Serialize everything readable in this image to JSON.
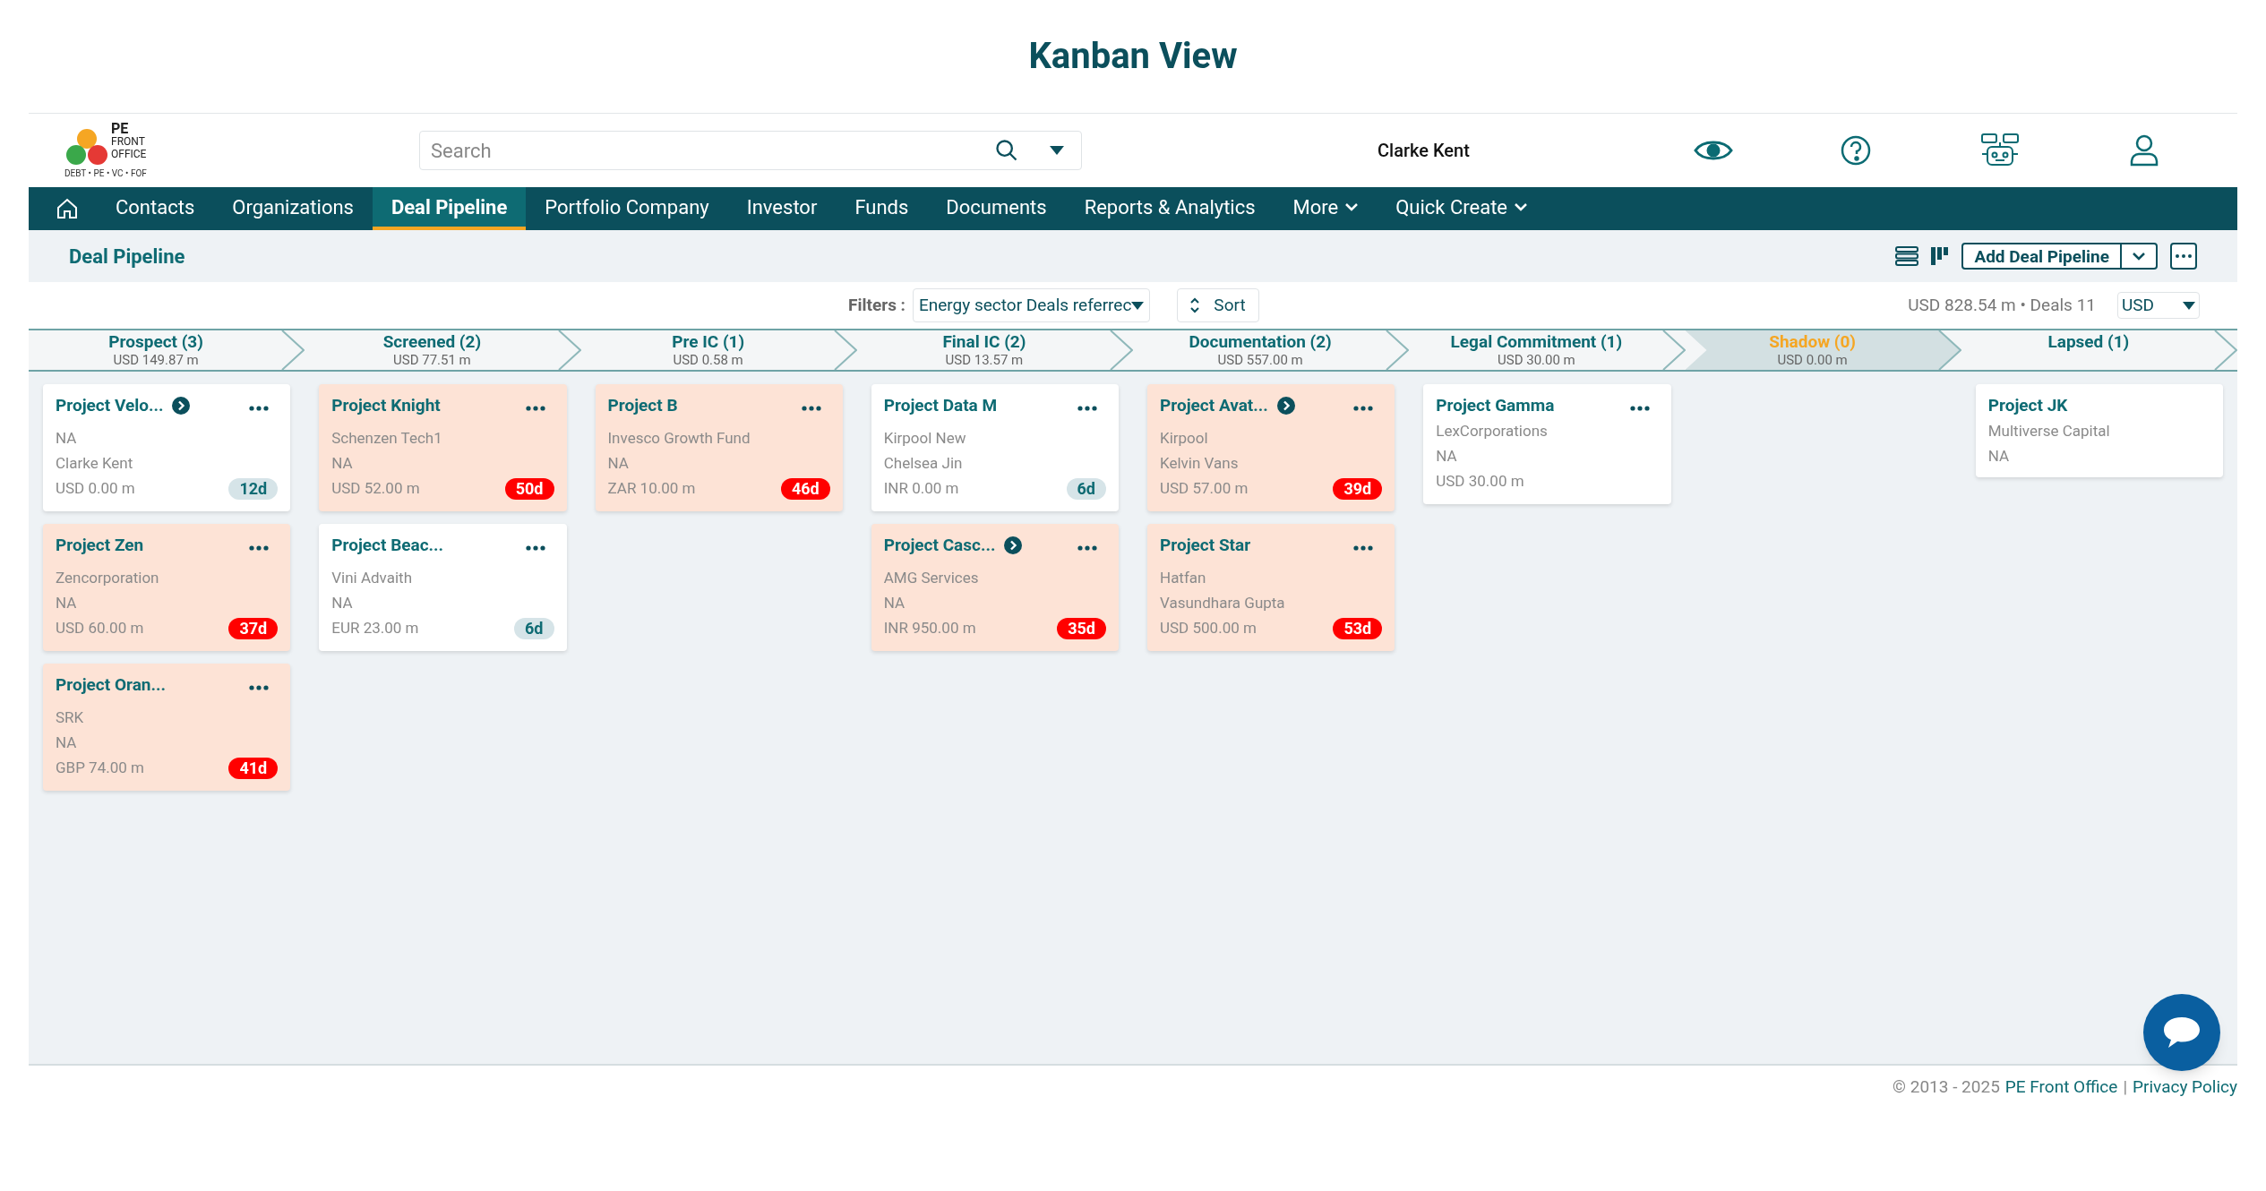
{
  "page_title": "Kanban View",
  "logo": {
    "line1": "PE",
    "line2": "FRONT",
    "line3": "OFFICE",
    "tagline": "DEBT • PE • VC • FOF"
  },
  "search": {
    "placeholder": "Search"
  },
  "user": {
    "name": "Clarke Kent"
  },
  "nav": [
    {
      "label": "Contacts",
      "selected": false
    },
    {
      "label": "Organizations",
      "selected": false
    },
    {
      "label": "Deal Pipeline",
      "selected": true
    },
    {
      "label": "Portfolio Company",
      "selected": false
    },
    {
      "label": "Investor",
      "selected": false
    },
    {
      "label": "Funds",
      "selected": false
    },
    {
      "label": "Documents",
      "selected": false
    },
    {
      "label": "Reports & Analytics",
      "selected": false
    },
    {
      "label": "More",
      "selected": false,
      "has_menu": true
    },
    {
      "label": "Quick Create",
      "selected": false,
      "has_menu": true
    }
  ],
  "section_title": "Deal Pipeline",
  "add_button": "Add Deal Pipeline",
  "filters": {
    "label": "Filters :",
    "value": "Energy sector Deals referrec",
    "sort": "Sort",
    "summary": "USD 828.54 m • Deals 11",
    "currency": "USD"
  },
  "stages": [
    {
      "name": "Prospect (3)",
      "amount": "USD 149.87 m",
      "selected": false,
      "cards": [
        {
          "title": "Project Velo...",
          "linked": true,
          "has_menu": true,
          "lines": [
            "NA",
            "Clarke Kent"
          ],
          "amount": "USD 0.00 m",
          "age": "12d",
          "overdue": false
        },
        {
          "title": "Project Zen",
          "linked": false,
          "has_menu": true,
          "lines": [
            "Zencorporation",
            "NA"
          ],
          "amount": "USD 60.00 m",
          "age": "37d",
          "overdue": true
        },
        {
          "title": "Project Oran...",
          "linked": false,
          "has_menu": true,
          "lines": [
            "SRK",
            "NA"
          ],
          "amount": "GBP 74.00 m",
          "age": "41d",
          "overdue": true
        }
      ]
    },
    {
      "name": "Screened (2)",
      "amount": "USD 77.51 m",
      "selected": false,
      "cards": [
        {
          "title": "Project Knight",
          "linked": false,
          "has_menu": true,
          "lines": [
            "Schenzen Tech1",
            "NA"
          ],
          "amount": "USD 52.00 m",
          "age": "50d",
          "overdue": true
        },
        {
          "title": "Project Beac...",
          "linked": false,
          "has_menu": true,
          "lines": [
            "Vini Advaith",
            "NA"
          ],
          "amount": "EUR 23.00 m",
          "age": "6d",
          "overdue": false
        }
      ]
    },
    {
      "name": "Pre IC (1)",
      "amount": "USD 0.58 m",
      "selected": false,
      "cards": [
        {
          "title": "Project B",
          "linked": false,
          "has_menu": true,
          "lines": [
            "Invesco Growth Fund",
            "NA"
          ],
          "amount": "ZAR 10.00 m",
          "age": "46d",
          "overdue": true
        }
      ]
    },
    {
      "name": "Final IC (2)",
      "amount": "USD 13.57 m",
      "selected": false,
      "cards": [
        {
          "title": "Project Data M",
          "linked": false,
          "has_menu": true,
          "lines": [
            "Kirpool New",
            "Chelsea Jin"
          ],
          "amount": "INR 0.00 m",
          "age": "6d",
          "overdue": false
        },
        {
          "title": "Project Casc...",
          "linked": true,
          "has_menu": true,
          "lines": [
            "AMG Services",
            "NA"
          ],
          "amount": "INR 950.00 m",
          "age": "35d",
          "overdue": true
        }
      ]
    },
    {
      "name": "Documentation (2)",
      "amount": "USD 557.00 m",
      "selected": false,
      "cards": [
        {
          "title": "Project Avat...",
          "linked": true,
          "has_menu": true,
          "lines": [
            "Kirpool",
            "Kelvin Vans"
          ],
          "amount": "USD 57.00 m",
          "age": "39d",
          "overdue": true
        },
        {
          "title": "Project Star",
          "linked": false,
          "has_menu": true,
          "lines": [
            "Hatfan",
            "Vasundhara Gupta"
          ],
          "amount": "USD 500.00 m",
          "age": "53d",
          "overdue": true
        }
      ]
    },
    {
      "name": "Legal Commitment (1)",
      "amount": "USD 30.00 m",
      "selected": false,
      "cards": [
        {
          "title": "Project Gamma",
          "linked": false,
          "has_menu": true,
          "lines": [
            "LexCorporations",
            "NA"
          ],
          "amount": "USD 30.00 m",
          "overdue": false
        }
      ]
    },
    {
      "name": "Shadow (0)",
      "amount": "USD 0.00 m",
      "selected": true
    },
    {
      "name": "Lapsed (1)",
      "selected": false,
      "cards": [
        {
          "title": "Project JK",
          "lines": [
            "Multiverse Capital",
            "NA"
          ],
          "overdue": false
        }
      ]
    }
  ],
  "footer": {
    "copyright": "© 2013 - 2025",
    "company_link": "PE Front Office",
    "separator": "|",
    "policy_link": "Privacy Policy"
  }
}
